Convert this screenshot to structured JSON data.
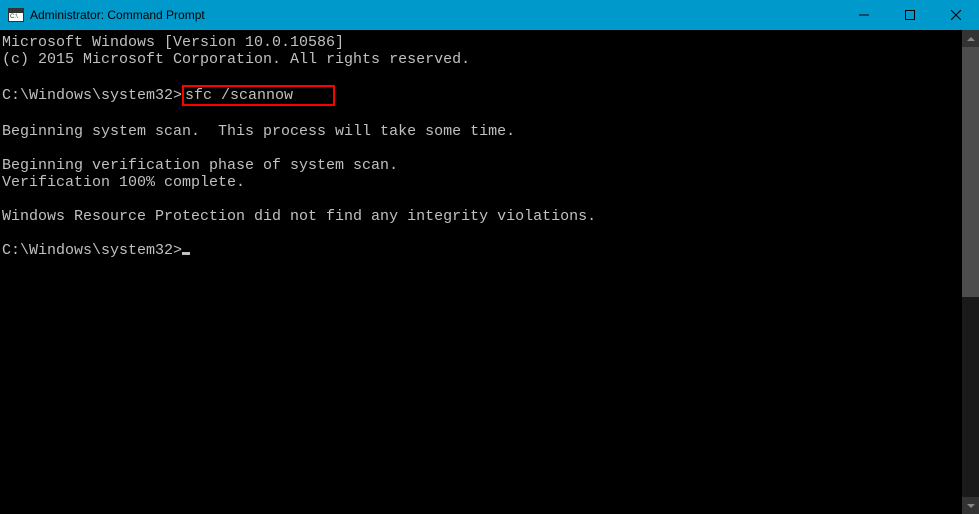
{
  "window": {
    "title": "Administrator: Command Prompt"
  },
  "terminal": {
    "line1": "Microsoft Windows [Version 10.0.10586]",
    "line2": "(c) 2015 Microsoft Corporation. All rights reserved.",
    "prompt1": "C:\\Windows\\system32>",
    "command": "sfc /scannow",
    "line3": "Beginning system scan.  This process will take some time.",
    "line4": "Beginning verification phase of system scan.",
    "line5": "Verification 100% complete.",
    "line6": "Windows Resource Protection did not find any integrity violations.",
    "prompt2": "C:\\Windows\\system32>"
  }
}
